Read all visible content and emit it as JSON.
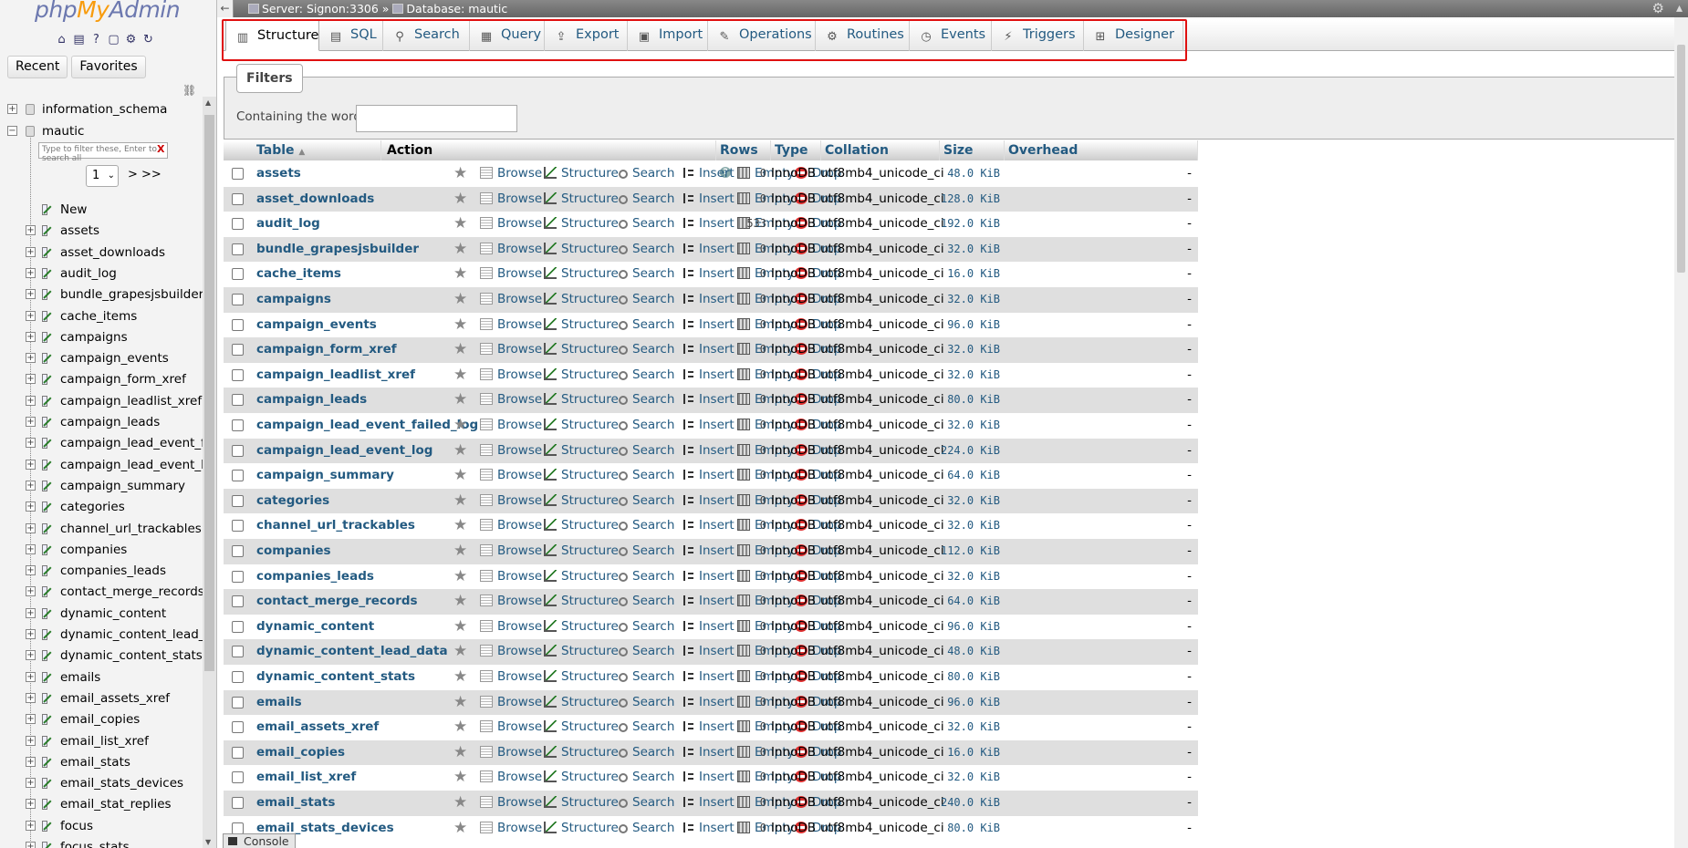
{
  "app": {
    "logo_php": "php",
    "logo_my": "My",
    "logo_admin": "Admin"
  },
  "nav": {
    "recent_label": "Recent",
    "favorites_label": "Favorites",
    "filter_placeholder": "Type to filter these, Enter to search all",
    "filter_clear": "X",
    "page_value": "1",
    "page_next": "> >>",
    "databases": [
      {
        "name": "information_schema",
        "expanded": false
      },
      {
        "name": "mautic",
        "expanded": true
      }
    ],
    "new_label": "New",
    "tables": [
      "assets",
      "asset_downloads",
      "audit_log",
      "bundle_grapesjsbuilder",
      "cache_items",
      "campaigns",
      "campaign_events",
      "campaign_form_xref",
      "campaign_leadlist_xref",
      "campaign_leads",
      "campaign_lead_event_faile",
      "campaign_lead_event_log",
      "campaign_summary",
      "categories",
      "channel_url_trackables",
      "companies",
      "companies_leads",
      "contact_merge_records",
      "dynamic_content",
      "dynamic_content_lead_dat",
      "dynamic_content_stats",
      "emails",
      "email_assets_xref",
      "email_copies",
      "email_list_xref",
      "email_stats",
      "email_stats_devices",
      "email_stat_replies",
      "focus",
      "focus_stats"
    ]
  },
  "topbar": {
    "server": "Server: Signon:3306 »",
    "database": "Database: mautic"
  },
  "tabs": [
    {
      "label": "Structure",
      "icon": "structure-icon",
      "active": true
    },
    {
      "label": "SQL",
      "icon": "sql-icon",
      "active": false
    },
    {
      "label": "Search",
      "icon": "search-icon",
      "active": false
    },
    {
      "label": "Query",
      "icon": "query-icon",
      "active": false
    },
    {
      "label": "Export",
      "icon": "export-icon",
      "active": false
    },
    {
      "label": "Import",
      "icon": "import-icon",
      "active": false
    },
    {
      "label": "Operations",
      "icon": "wrench-icon",
      "active": false
    },
    {
      "label": "Routines",
      "icon": "routines-icon",
      "active": false
    },
    {
      "label": "Events",
      "icon": "clock-icon",
      "active": false
    },
    {
      "label": "Triggers",
      "icon": "triggers-icon",
      "active": false
    },
    {
      "label": "Designer",
      "icon": "designer-icon",
      "active": false
    }
  ],
  "filters": {
    "legend": "Filters",
    "label": "Containing the word:",
    "value": ""
  },
  "table": {
    "headers": {
      "table": "Table",
      "action": "Action",
      "rows": "Rows",
      "type": "Type",
      "collation": "Collation",
      "size": "Size",
      "overhead": "Overhead"
    },
    "actions": {
      "browse": "Browse",
      "structure": "Structure",
      "search": "Search",
      "insert": "Insert",
      "empty": "Empty",
      "drop": "Drop"
    },
    "rows": [
      {
        "name": "assets",
        "rows": "0",
        "type": "InnoDB",
        "collation": "utf8mb4_unicode_ci",
        "size": "48.0 KiB",
        "overhead": "-"
      },
      {
        "name": "asset_downloads",
        "rows": "0",
        "type": "InnoDB",
        "collation": "utf8mb4_unicode_ci",
        "size": "128.0 KiB",
        "overhead": "-"
      },
      {
        "name": "audit_log",
        "rows": "533",
        "type": "InnoDB",
        "collation": "utf8mb4_unicode_ci",
        "size": "192.0 KiB",
        "overhead": "-"
      },
      {
        "name": "bundle_grapesjsbuilder",
        "rows": "0",
        "type": "InnoDB",
        "collation": "utf8mb4_unicode_ci",
        "size": "32.0 KiB",
        "overhead": "-"
      },
      {
        "name": "cache_items",
        "rows": "0",
        "type": "InnoDB",
        "collation": "utf8mb4_unicode_ci",
        "size": "16.0 KiB",
        "overhead": "-"
      },
      {
        "name": "campaigns",
        "rows": "0",
        "type": "InnoDB",
        "collation": "utf8mb4_unicode_ci",
        "size": "32.0 KiB",
        "overhead": "-"
      },
      {
        "name": "campaign_events",
        "rows": "0",
        "type": "InnoDB",
        "collation": "utf8mb4_unicode_ci",
        "size": "96.0 KiB",
        "overhead": "-"
      },
      {
        "name": "campaign_form_xref",
        "rows": "0",
        "type": "InnoDB",
        "collation": "utf8mb4_unicode_ci",
        "size": "32.0 KiB",
        "overhead": "-"
      },
      {
        "name": "campaign_leadlist_xref",
        "rows": "0",
        "type": "InnoDB",
        "collation": "utf8mb4_unicode_ci",
        "size": "32.0 KiB",
        "overhead": "-"
      },
      {
        "name": "campaign_leads",
        "rows": "0",
        "type": "InnoDB",
        "collation": "utf8mb4_unicode_ci",
        "size": "80.0 KiB",
        "overhead": "-"
      },
      {
        "name": "campaign_lead_event_failed_log",
        "rows": "0",
        "type": "InnoDB",
        "collation": "utf8mb4_unicode_ci",
        "size": "32.0 KiB",
        "overhead": "-"
      },
      {
        "name": "campaign_lead_event_log",
        "rows": "0",
        "type": "InnoDB",
        "collation": "utf8mb4_unicode_ci",
        "size": "224.0 KiB",
        "overhead": "-"
      },
      {
        "name": "campaign_summary",
        "rows": "0",
        "type": "InnoDB",
        "collation": "utf8mb4_unicode_ci",
        "size": "64.0 KiB",
        "overhead": "-"
      },
      {
        "name": "categories",
        "rows": "0",
        "type": "InnoDB",
        "collation": "utf8mb4_unicode_ci",
        "size": "32.0 KiB",
        "overhead": "-"
      },
      {
        "name": "channel_url_trackables",
        "rows": "0",
        "type": "InnoDB",
        "collation": "utf8mb4_unicode_ci",
        "size": "32.0 KiB",
        "overhead": "-"
      },
      {
        "name": "companies",
        "rows": "0",
        "type": "InnoDB",
        "collation": "utf8mb4_unicode_ci",
        "size": "112.0 KiB",
        "overhead": "-"
      },
      {
        "name": "companies_leads",
        "rows": "0",
        "type": "InnoDB",
        "collation": "utf8mb4_unicode_ci",
        "size": "32.0 KiB",
        "overhead": "-"
      },
      {
        "name": "contact_merge_records",
        "rows": "0",
        "type": "InnoDB",
        "collation": "utf8mb4_unicode_ci",
        "size": "64.0 KiB",
        "overhead": "-"
      },
      {
        "name": "dynamic_content",
        "rows": "0",
        "type": "InnoDB",
        "collation": "utf8mb4_unicode_ci",
        "size": "96.0 KiB",
        "overhead": "-"
      },
      {
        "name": "dynamic_content_lead_data",
        "rows": "0",
        "type": "InnoDB",
        "collation": "utf8mb4_unicode_ci",
        "size": "48.0 KiB",
        "overhead": "-"
      },
      {
        "name": "dynamic_content_stats",
        "rows": "0",
        "type": "InnoDB",
        "collation": "utf8mb4_unicode_ci",
        "size": "80.0 KiB",
        "overhead": "-"
      },
      {
        "name": "emails",
        "rows": "0",
        "type": "InnoDB",
        "collation": "utf8mb4_unicode_ci",
        "size": "96.0 KiB",
        "overhead": "-"
      },
      {
        "name": "email_assets_xref",
        "rows": "0",
        "type": "InnoDB",
        "collation": "utf8mb4_unicode_ci",
        "size": "32.0 KiB",
        "overhead": "-"
      },
      {
        "name": "email_copies",
        "rows": "0",
        "type": "InnoDB",
        "collation": "utf8mb4_unicode_ci",
        "size": "16.0 KiB",
        "overhead": "-"
      },
      {
        "name": "email_list_xref",
        "rows": "0",
        "type": "InnoDB",
        "collation": "utf8mb4_unicode_ci",
        "size": "32.0 KiB",
        "overhead": "-"
      },
      {
        "name": "email_stats",
        "rows": "0",
        "type": "InnoDB",
        "collation": "utf8mb4_unicode_ci",
        "size": "240.0 KiB",
        "overhead": "-"
      },
      {
        "name": "email_stats_devices",
        "rows": "0",
        "type": "InnoDB",
        "collation": "utf8mb4_unicode_ci",
        "size": "80.0 KiB",
        "overhead": "-"
      }
    ]
  },
  "console": {
    "label": "Console"
  },
  "colors": {
    "link": "#235a81",
    "highlight": "#e01010",
    "row_alt": "#dfdfdf"
  }
}
